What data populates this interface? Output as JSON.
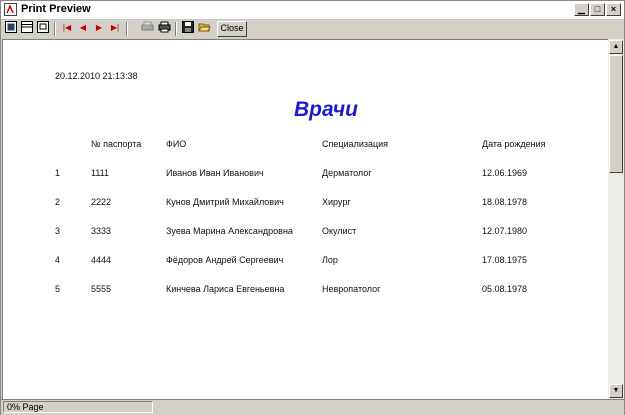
{
  "window": {
    "title": "Print Preview"
  },
  "toolbar": {
    "close_label": "Close"
  },
  "report": {
    "timestamp": "20.12.2010 21:13:38",
    "title": "Врачи",
    "headers": [
      "№ паспорта",
      "ФИО",
      "Специализация",
      "Дата рождения"
    ],
    "rows": [
      {
        "num": "1",
        "passport": "1111",
        "name": "Иванов Иван Иванович",
        "spec": "Дерматолог",
        "birth": "12.06.1969"
      },
      {
        "num": "2",
        "passport": "2222",
        "name": "Кунов Дмитрий Михайлович",
        "spec": "Хирург",
        "birth": "18.08.1978"
      },
      {
        "num": "3",
        "passport": "3333",
        "name": "Зуева Марина Александровна",
        "spec": "Окулист",
        "birth": "12.07.1980"
      },
      {
        "num": "4",
        "passport": "4444",
        "name": "Фёдоров Андрей Сергеевич",
        "spec": "Лор",
        "birth": "17.08.1975"
      },
      {
        "num": "5",
        "passport": "5555",
        "name": "Кинчева Лариса Евгеньевна",
        "spec": "Невропатолог",
        "birth": "05.08.1978"
      }
    ]
  },
  "status": {
    "zoom_text": "0% Page"
  }
}
